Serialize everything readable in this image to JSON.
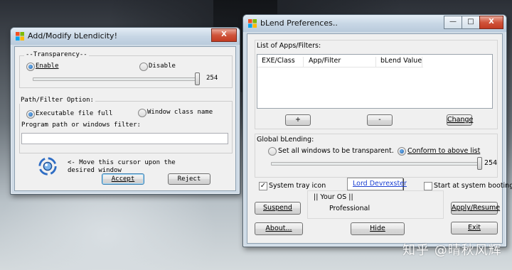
{
  "wallpaper": {
    "watermark": "知乎 @晴秋风辉"
  },
  "left_window": {
    "title": "Add/Modify bLendicity!",
    "caption_buttons": {
      "close": "X"
    },
    "transparency": {
      "legend": "--Transparency--",
      "enable_label": "Enable",
      "disable_label": "Disable",
      "enabled": true,
      "slider_value": "254",
      "slider_max": 255
    },
    "path_filter": {
      "legend": "Path/Filter Option:",
      "exe_label": "Executable file full",
      "class_label": "Window class name",
      "exe_selected": true,
      "input_label": "Program path or windows filter:",
      "input_value": ""
    },
    "cursor_hint": "<- Move this cursor upon the desired window",
    "accept_label": "Accept",
    "reject_label": "Reject"
  },
  "right_window": {
    "title": "bLend Preferences..",
    "caption_buttons": {
      "minimize": "—",
      "maximize": "□",
      "close": "X"
    },
    "apps_group": {
      "legend": "List of Apps/Filters:",
      "columns": [
        "EXE/Class",
        "App/Filter",
        "bLend Value"
      ],
      "rows": [],
      "add_label": "+",
      "remove_label": "-",
      "change_label": "Change"
    },
    "global_group": {
      "legend": "Global bLending:",
      "all_windows_label": "Set all windows to be transparent.",
      "conform_label": "Conform to above list",
      "conform_selected": true,
      "slider_value": "254",
      "slider_max": 255
    },
    "system_tray_label": "System tray icon",
    "system_tray_checked": true,
    "author_link": "Lord Devrexster",
    "start_boot_label": "Start at system booting.",
    "start_boot_checked": false,
    "os_caption": "|| Your OS ||",
    "os_value": "Professional",
    "suspend_label": "Suspend",
    "apply_label": "Apply/Resume",
    "about_label": "About...",
    "hide_label": "Hide",
    "exit_label": "Exit"
  }
}
